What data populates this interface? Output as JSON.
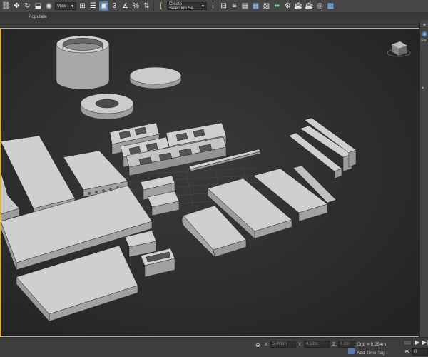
{
  "toolbar": {
    "view_dropdown": "View",
    "snaps_label": "3",
    "selection_set_dropdown": "Create Selection Se"
  },
  "ribbon": {
    "tabs": [
      "",
      "Populate"
    ]
  },
  "command_panel": {
    "tab_label": "Sta"
  },
  "status": {
    "x_label": "X:",
    "x_value": "5,498m",
    "y_label": "Y:",
    "y_value": "4,12m",
    "z_label": "Z:",
    "z_value": "0,0m",
    "grid_text": "Grid = 0,254m",
    "add_time_tag": "Add Time Tag",
    "frame_value": "0"
  },
  "colors": {
    "viewport_bg": "#2b2b2b",
    "active_viewport_border": "#d9b33e",
    "object_top": "#cdcdcd",
    "object_side": "#9c9c9c",
    "object_dark": "#777777"
  }
}
